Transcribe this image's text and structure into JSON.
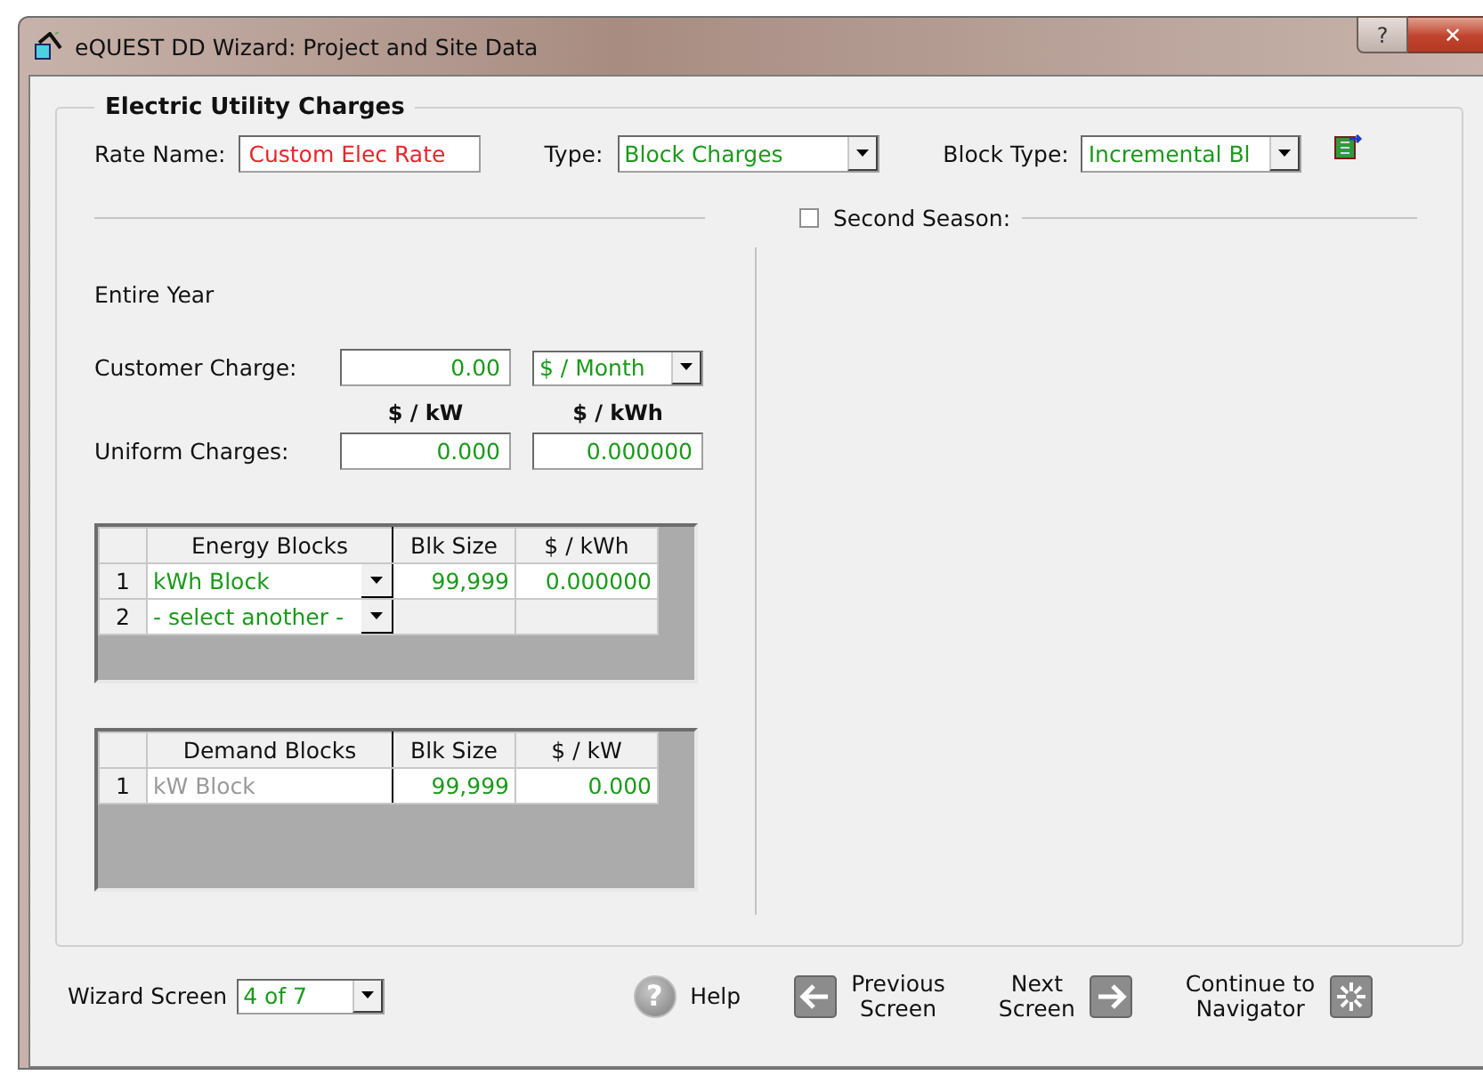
{
  "window": {
    "title": "eQUEST DD Wizard:  Project and Site Data",
    "help_button": "?",
    "close_button": "✕"
  },
  "group": {
    "title": "Electric Utility Charges"
  },
  "rate_name": {
    "label": "Rate Name:",
    "value": "Custom Elec Rate"
  },
  "type": {
    "label": "Type:",
    "value": "Block Charges"
  },
  "block_type": {
    "label": "Block Type:",
    "value": "Incremental Bl"
  },
  "second_season": {
    "label": "Second Season:",
    "checked": false
  },
  "season": "Entire Year",
  "customer_charge": {
    "label": "Customer Charge:",
    "value": "0.00",
    "unit": "$ / Month"
  },
  "uniform_charges": {
    "label": "Uniform Charges:",
    "columns": [
      "$ / kW",
      "$ / kWh"
    ],
    "values": [
      "0.000",
      "0.000000"
    ]
  },
  "energy_blocks": {
    "columns": [
      "Energy Blocks",
      "Blk Size",
      "$ / kWh"
    ],
    "rows": [
      {
        "number": "1",
        "block": "kWh Block",
        "size": "99,999",
        "rate": "0.000000",
        "disabled": false
      },
      {
        "number": "2",
        "block": "- select another -",
        "disabled": false
      }
    ]
  },
  "demand_blocks": {
    "columns": [
      "Demand Blocks",
      "Blk Size",
      "$ / kW"
    ],
    "rows": [
      {
        "number": "1",
        "block": "kW Block",
        "size": "99,999",
        "rate": "0.000",
        "disabled": true
      }
    ]
  },
  "footer": {
    "wizard_screen_label": "Wizard Screen",
    "wizard_screen_value": "4 of 7",
    "buttons": [
      {
        "kind": "help",
        "icon": "?",
        "lines": [
          "Help"
        ]
      },
      {
        "kind": "previous",
        "lines": [
          "Previous",
          "Screen"
        ]
      },
      {
        "kind": "next",
        "lines": [
          "Next",
          "Screen"
        ]
      },
      {
        "kind": "continue",
        "lines": [
          "Continue to",
          "Navigator"
        ]
      }
    ]
  }
}
